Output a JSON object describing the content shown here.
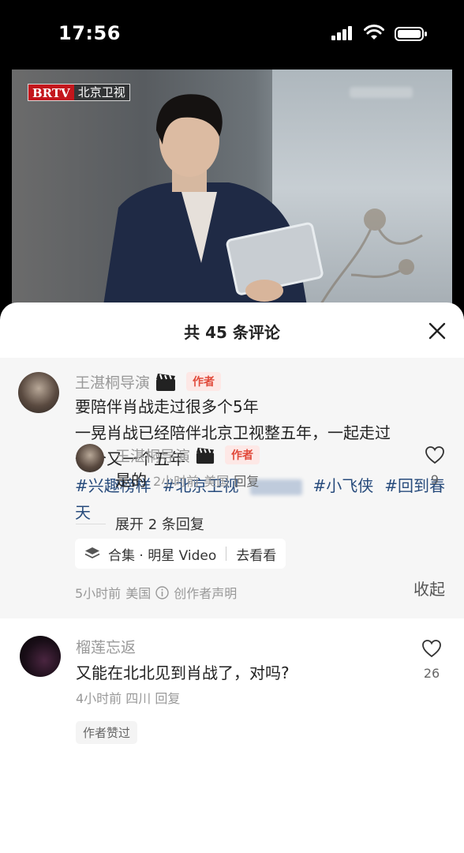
{
  "status_bar": {
    "time": "17:56"
  },
  "video": {
    "channel_logo": "BRTV",
    "channel_name": "北京卫视"
  },
  "sheet": {
    "title": "共 45 条评论",
    "close_icon": "close-icon"
  },
  "pinned_comment": {
    "author": "王湛桐导演",
    "author_badge": "作者",
    "lines": [
      "要陪伴肖战走过很多个5年",
      "一晃肖战已经陪伴北京卫视整五年，一起走过",
      "一个又一个五年"
    ],
    "tags": [
      "#兴趣榜样",
      "#北京卫视",
      "#小飞侠",
      "#回到春天"
    ],
    "collection_label": "合集 · 明星 Video",
    "collection_action": "去看看",
    "time": "5小时前",
    "location": "美国",
    "declaration": "创作者声明",
    "collapse": "收起"
  },
  "comment": {
    "author": "榴莲忘返",
    "text": "又能在北北见到肖战了，对吗?",
    "time": "4小时前",
    "location": "四川",
    "reply_label": "回复",
    "likes": "26",
    "liked_by_author": "作者赞过"
  },
  "reply": {
    "author": "王湛桐导演",
    "author_badge": "作者",
    "text": "是的",
    "time": "2小时前",
    "location": "美国",
    "reply_label": "回复",
    "likes": "9"
  },
  "expand_replies": "展开 2 条回复"
}
